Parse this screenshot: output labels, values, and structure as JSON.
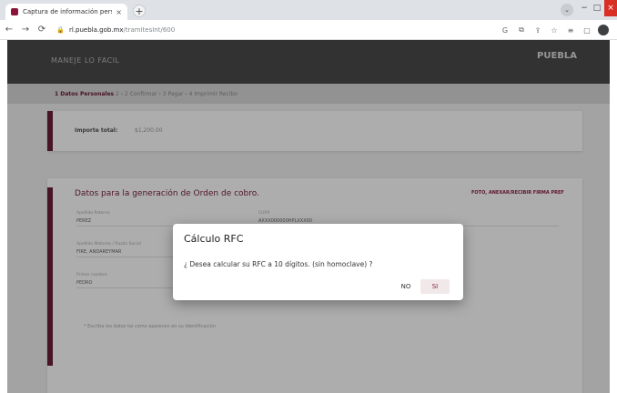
{
  "browser": {
    "tab_title": "Captura de información personal",
    "tab_close": "×",
    "new_tab": "+",
    "url_host": "rl.puebla.gob.mx",
    "url_path": "/tramitesInt/600",
    "minimize": "−",
    "maximize": "□",
    "close": "×",
    "tab_search": "⌄"
  },
  "page": {
    "header_title": "MANEJE LO FACIL",
    "header_logo": "PUEBLA",
    "steps": {
      "active": "1 Datos Personales",
      "rest": " 2 ›  2 Confirmar  ›  3 Pagar  ›  4 Imprimir Recibo"
    },
    "summary": {
      "label": "Importe total:",
      "value": "$1,200.00"
    },
    "section": {
      "title": "Datos para la generación de Orden de cobro.",
      "link": "FOTO, ANEXAR/RECIBIR FIRMA PREF"
    },
    "fields": [
      {
        "label": "Apellido Paterno",
        "value": "PEREZ"
      },
      {
        "label": "CURP",
        "value": "AXXX000000HPLXXX00"
      },
      {
        "label": "Apellido Materno / Razón Social",
        "value": "FIRE, ANDAREYMAR"
      },
      {
        "label": "Primer nombre",
        "value": "PEDRO"
      }
    ],
    "note": "* Escriba los datos tal como aparecen en su identificación"
  },
  "modal": {
    "title": "Cálculo RFC",
    "message": "¿ Desea calcular su RFC a 10 dígitos. (sin homoclave) ?",
    "no_label": "NO",
    "si_label": "SI"
  },
  "colors": {
    "accent": "#6a1f38",
    "si_button_bg": "#f1e8ea"
  }
}
